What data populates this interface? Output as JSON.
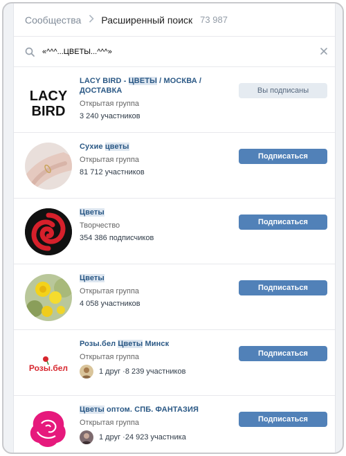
{
  "breadcrumb": {
    "root": "Сообщества",
    "current": "Расширенный поиск",
    "count": "73 987"
  },
  "search": {
    "value": "«^^^...ЦВЕТЫ...^^^»"
  },
  "colors": {
    "accent": "#5181b8",
    "link": "#2a5885",
    "highlight": "#dde6f0"
  },
  "results": [
    {
      "name_pre": "LACY BIRD - ",
      "name_hl": "ЦВЕТЫ",
      "name_post": " / МОСКВА / ДОСТАВКА",
      "type": "Открытая группа",
      "members": "3 240 участников",
      "friend": "",
      "button": "Вы подписаны",
      "subscribed": true,
      "avatar": "lacy-bird-logo"
    },
    {
      "name_pre": "Сухие ",
      "name_hl": "цветы",
      "name_post": "",
      "type": "Открытая группа",
      "members": "81 712 участников",
      "friend": "",
      "button": "Подписаться",
      "subscribed": false,
      "avatar": "ring-hand-photo"
    },
    {
      "name_pre": "",
      "name_hl": "Цветы",
      "name_post": "",
      "type": "Творчество",
      "members": "354 386 подписчиков",
      "friend": "",
      "button": "Подписаться",
      "subscribed": false,
      "avatar": "red-swirl-logo"
    },
    {
      "name_pre": "",
      "name_hl": "Цветы",
      "name_post": "",
      "type": "Открытая группа",
      "members": "4 058 участников",
      "friend": "",
      "button": "Подписаться",
      "subscribed": false,
      "avatar": "yellow-flowers-photo"
    },
    {
      "name_pre": "Розы.бел ",
      "name_hl": "Цветы",
      "name_post": " Минск",
      "type": "Открытая группа",
      "members": "8 239 участников",
      "friend": "1 друг · ",
      "button": "Подписаться",
      "subscribed": false,
      "avatar": "rozy-bel-logo"
    },
    {
      "name_pre": "",
      "name_hl": "Цветы",
      "name_post": " оптом. СПБ. ФАНТАЗИЯ",
      "type": "Открытая группа",
      "members": "24 923 участника",
      "friend": "1 друг · ",
      "button": "Подписаться",
      "subscribed": false,
      "avatar": "pink-rose-logo"
    }
  ],
  "logos": {
    "lacy_line1": "LACY",
    "lacy_line2": "BIRD",
    "rozy_text": "Розы.бел"
  }
}
